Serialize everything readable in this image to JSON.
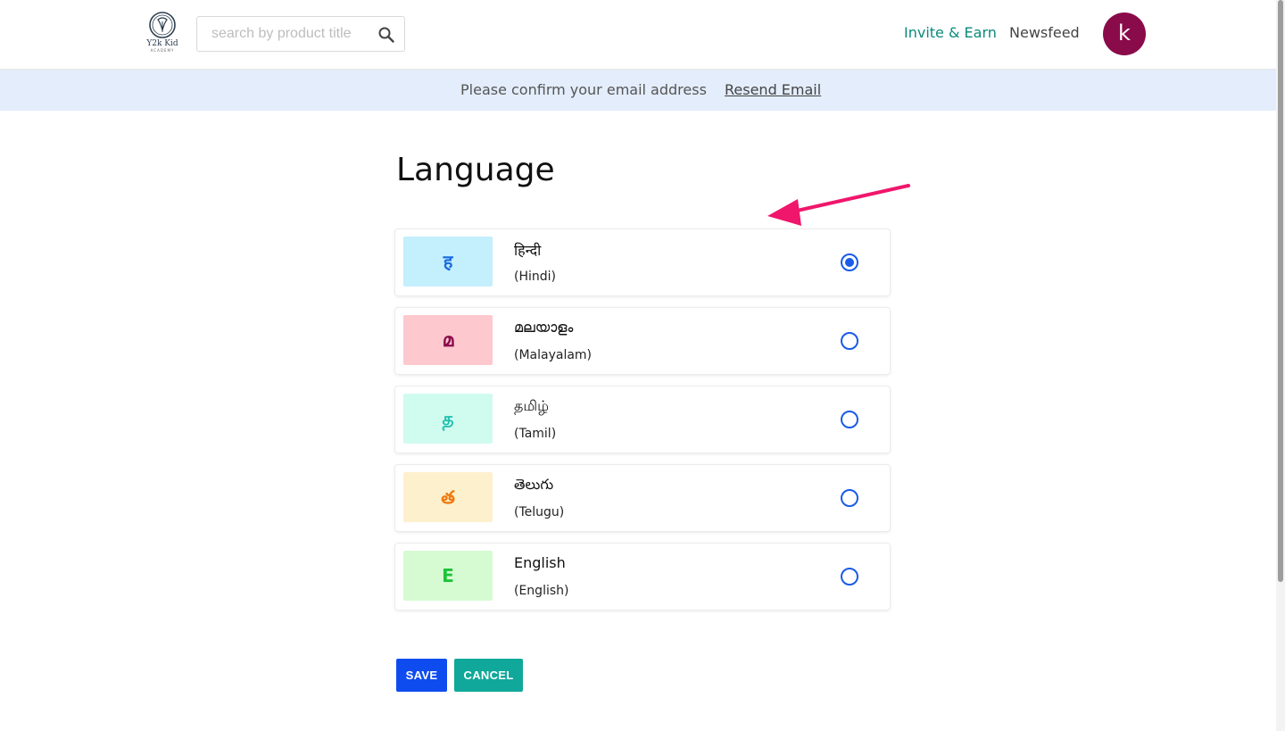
{
  "header": {
    "logo_text": "Y2k Kid",
    "logo_subtext": "ACADEMY",
    "search_placeholder": "search by product title",
    "search_value": "",
    "nav": {
      "invite_label": "Invite & Earn",
      "newsfeed_label": "Newsfeed"
    },
    "avatar_letter": "k",
    "colors": {
      "invite": "#0a8a7a",
      "avatar_bg": "#8a0b4a"
    }
  },
  "banner": {
    "message": "Please confirm your email address",
    "link_label": "Resend Email"
  },
  "page": {
    "title": "Language"
  },
  "languages": [
    {
      "glyph": "ह",
      "native": "हिन्दी",
      "english": "(Hindi)",
      "selected": true,
      "bg": "#c4effc",
      "fg": "#1a6be0"
    },
    {
      "glyph": "മ",
      "native": "മലയാളം",
      "english": "(Malayalam)",
      "selected": false,
      "bg": "#fdc8ce",
      "fg": "#8a0b4a"
    },
    {
      "glyph": "த",
      "native": "தமிழ்",
      "english": "(Tamil)",
      "selected": false,
      "bg": "#d0fbef",
      "fg": "#1fc0b0"
    },
    {
      "glyph": "త",
      "native": "తెలుగు",
      "english": "(Telugu)",
      "selected": false,
      "bg": "#fdf0cd",
      "fg": "#f07a10"
    },
    {
      "glyph": "E",
      "native": "English",
      "english": "(English)",
      "selected": false,
      "bg": "#d6fbd2",
      "fg": "#1ec23a"
    }
  ],
  "actions": {
    "save_label": "SAVE",
    "cancel_label": "CANCEL",
    "save_color": "#0f4cf0",
    "cancel_color": "#10a89a"
  },
  "annotation": {
    "arrow_color": "#f0166c"
  }
}
